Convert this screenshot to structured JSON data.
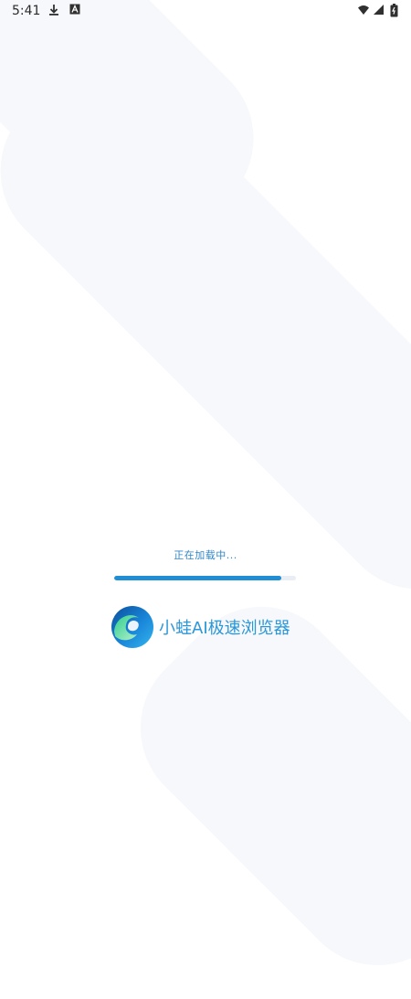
{
  "status_bar": {
    "time": "5:41",
    "icons": [
      "download-icon",
      "font-a-icon",
      "wifi-icon",
      "signal-icon",
      "battery-icon"
    ]
  },
  "loading": {
    "text": "正在加载中...",
    "progress": 0.92
  },
  "brand": {
    "name": "小蛙AI极速浏览器"
  },
  "colors": {
    "accent": "#1f8ed4",
    "background_shape": "#f7f8fb"
  }
}
